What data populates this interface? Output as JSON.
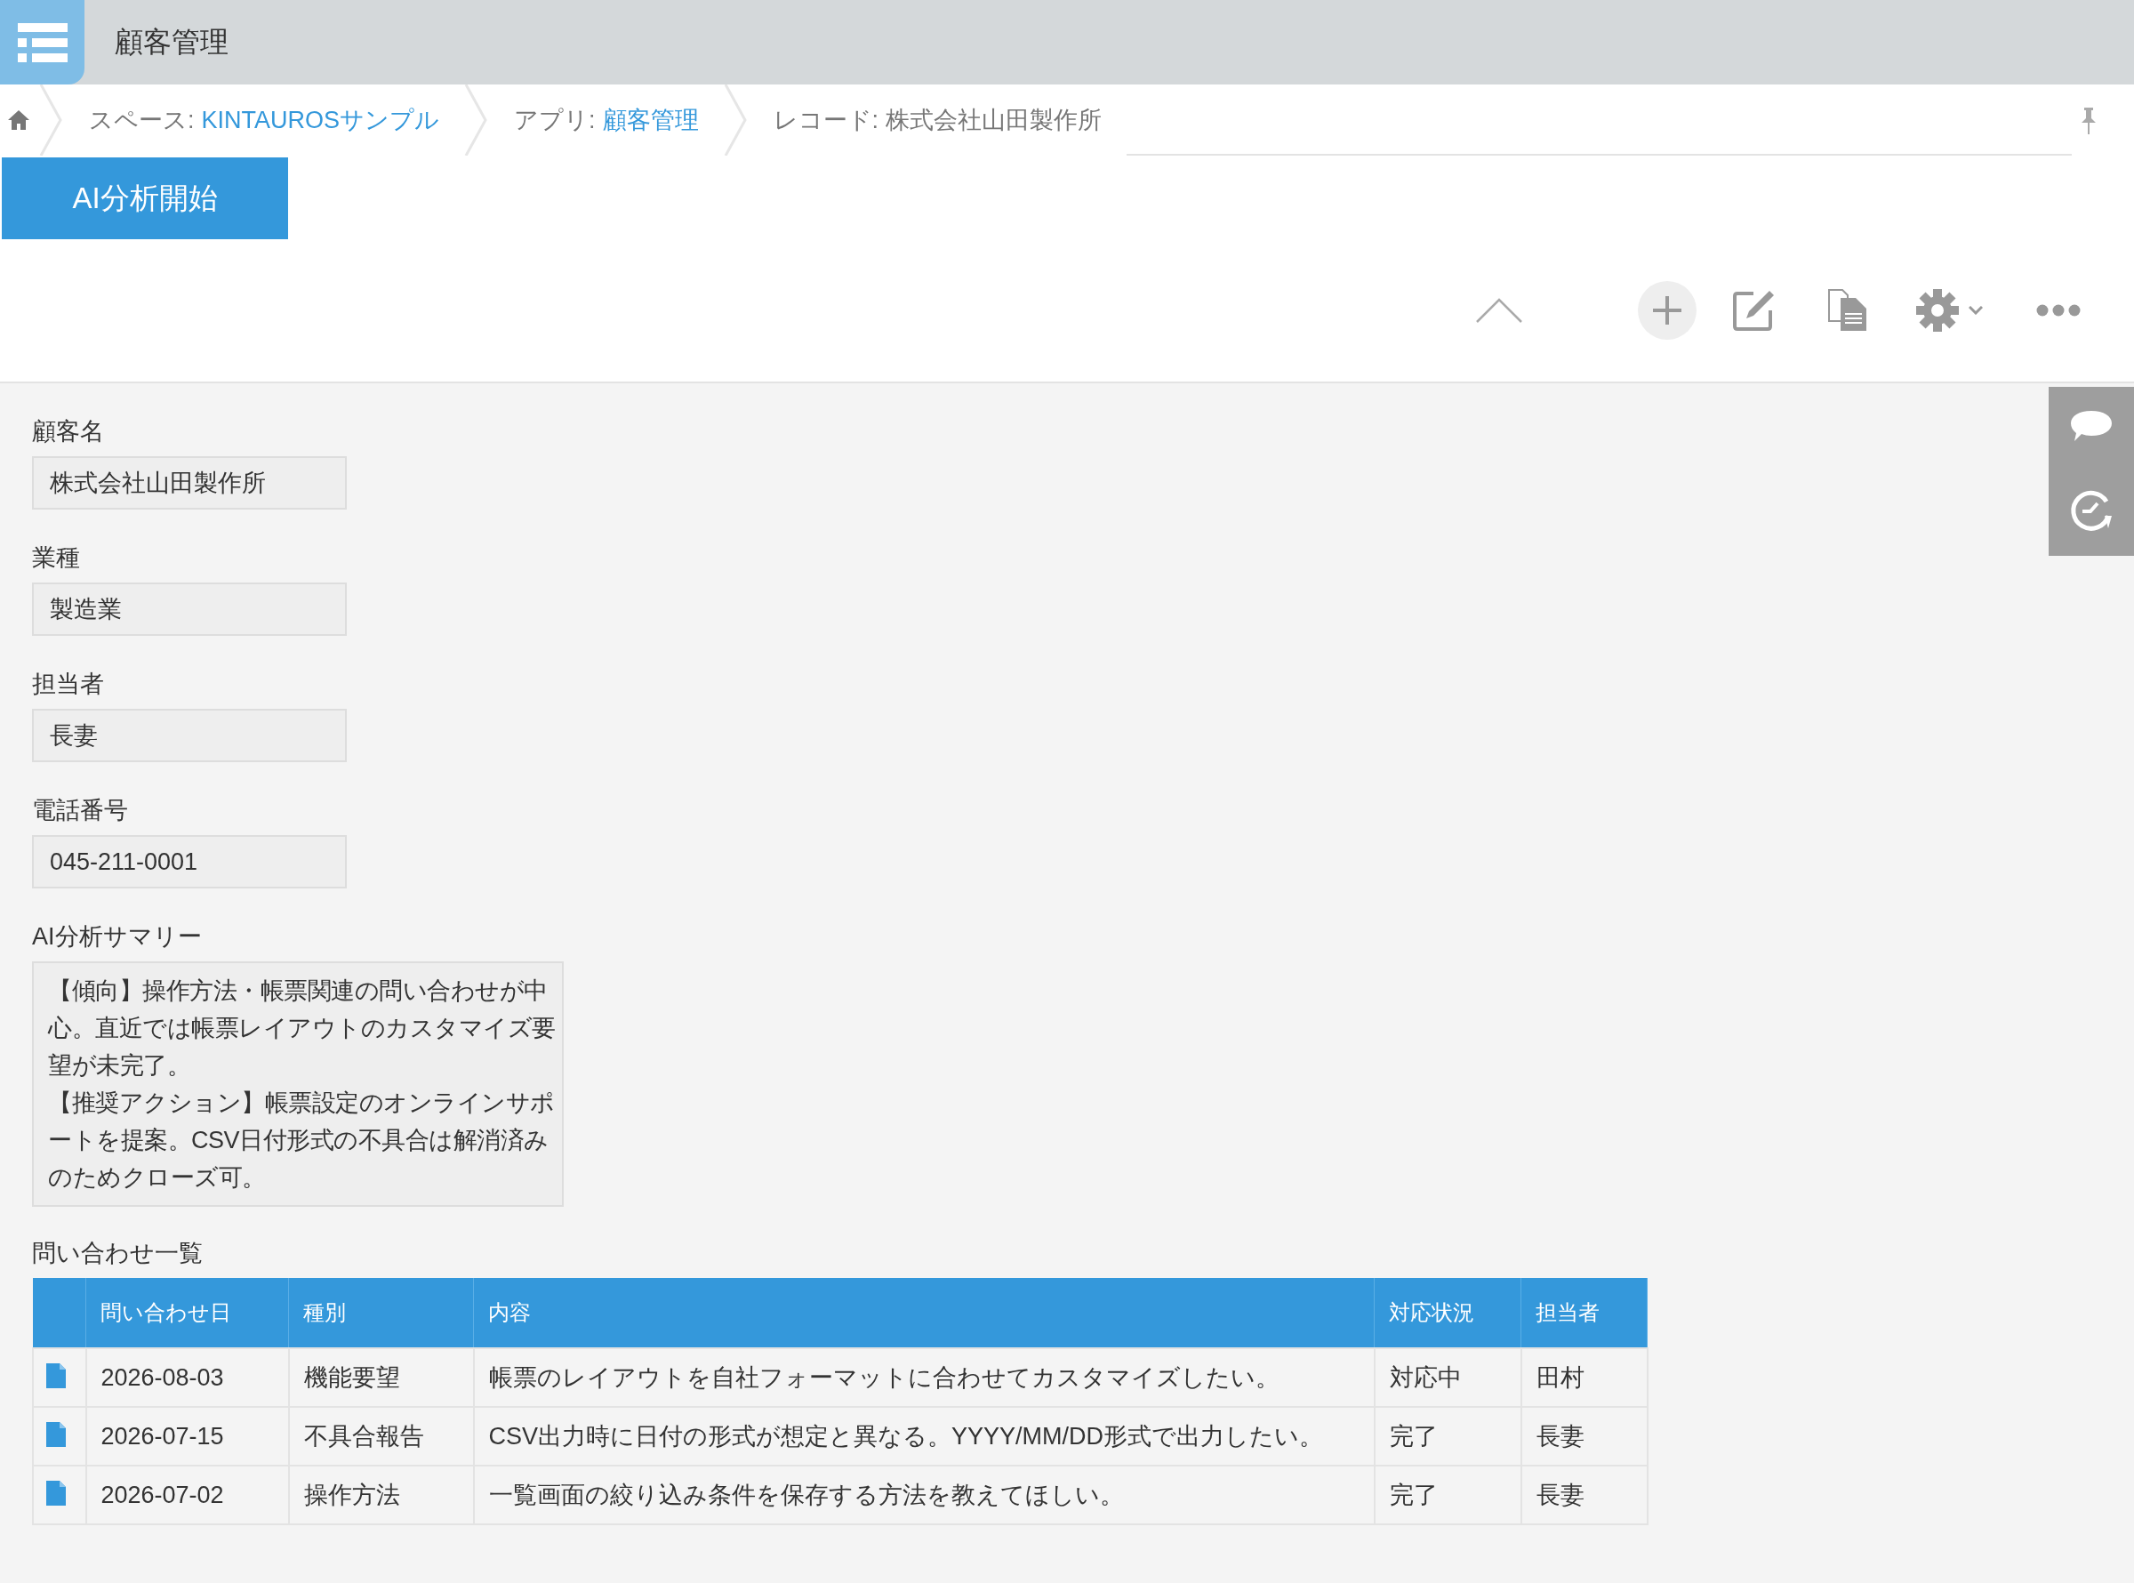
{
  "header": {
    "app_title": "顧客管理"
  },
  "breadcrumb": [
    {
      "prefix": "スペース:",
      "link": "KINTAUROSサンプル"
    },
    {
      "prefix": "アプリ:",
      "link": "顧客管理"
    },
    {
      "text": "レコード: 株式会社山田製作所"
    }
  ],
  "action_button": "AI分析開始",
  "fields": [
    {
      "kind": "single",
      "label": "顧客名",
      "value": "株式会社山田製作所"
    },
    {
      "kind": "single",
      "label": "業種",
      "value": "製造業"
    },
    {
      "kind": "single",
      "label": "担当者",
      "value": "長妻"
    },
    {
      "kind": "single",
      "label": "電話番号",
      "value": "045-211-0001"
    },
    {
      "kind": "multi",
      "label": "AI分析サマリー",
      "paragraphs": [
        "【傾向】操作方法・帳票関連の問い合わせが中心。直近では帳票レイアウトのカスタマイズ要望が未完了。",
        "【推奨アクション】帳票設定のオンラインサポートを提案。CSV日付形式の不具合は解消済みのためクローズ可。"
      ]
    }
  ],
  "table": {
    "title": "問い合わせ一覧",
    "columns": [
      "問い合わせ日",
      "種別",
      "内容",
      "対応状況",
      "担当者"
    ],
    "rows": [
      {
        "cells": [
          "2026-08-03",
          "機能要望",
          "帳票のレイアウトを自社フォーマットに合わせてカスタマイズしたい。",
          "対応中",
          "田村"
        ]
      },
      {
        "cells": [
          "2026-07-15",
          "不具合報告",
          "CSV出力時に日付の形式が想定と異なる。YYYY/MM/DD形式で出力したい。",
          "完了",
          "長妻"
        ]
      },
      {
        "cells": [
          "2026-07-02",
          "操作方法",
          "一覧画面の絞り込み条件を保存する方法を教えてほしい。",
          "完了",
          "長妻"
        ]
      }
    ]
  }
}
